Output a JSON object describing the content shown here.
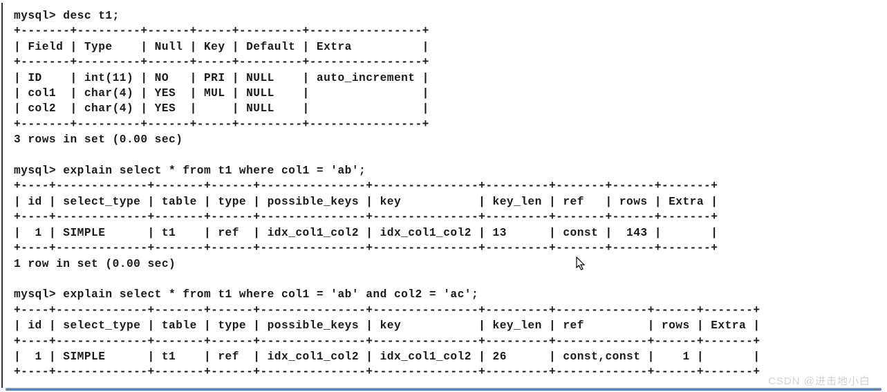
{
  "terminal": {
    "lines": [
      "mysql> desc t1;",
      "+-------+---------+------+-----+---------+----------------+",
      "| Field | Type    | Null | Key | Default | Extra          |",
      "+-------+---------+------+-----+---------+----------------+",
      "| ID    | int(11) | NO   | PRI | NULL    | auto_increment |",
      "| col1  | char(4) | YES  | MUL | NULL    |                |",
      "| col2  | char(4) | YES  |     | NULL    |                |",
      "+-------+---------+------+-----+---------+----------------+",
      "3 rows in set (0.00 sec)",
      "",
      "mysql> explain select * from t1 where col1 = 'ab';",
      "+----+-------------+-------+------+---------------+---------------+---------+-------+------+-------+",
      "| id | select_type | table | type | possible_keys | key           | key_len | ref   | rows | Extra |",
      "+----+-------------+-------+------+---------------+---------------+---------+-------+------+-------+",
      "|  1 | SIMPLE      | t1    | ref  | idx_col1_col2 | idx_col1_col2 | 13      | const |  143 |       |",
      "+----+-------------+-------+------+---------------+---------------+---------+-------+------+-------+",
      "1 row in set (0.00 sec)",
      "",
      "mysql> explain select * from t1 where col1 = 'ab' and col2 = 'ac';",
      "+----+-------------+-------+------+---------------+---------------+---------+-------------+------+-------+",
      "| id | select_type | table | type | possible_keys | key           | key_len | ref         | rows | Extra |",
      "+----+-------------+-------+------+---------------+---------------+---------+-------------+------+-------+",
      "|  1 | SIMPLE      | t1    | ref  | idx_col1_col2 | idx_col1_col2 | 26      | const,const |    1 |       |",
      "+----+-------------+-------+------+---------------+---------------+---------+-------------+------+-------+"
    ]
  },
  "watermark": "CSDN @进击地小白"
}
